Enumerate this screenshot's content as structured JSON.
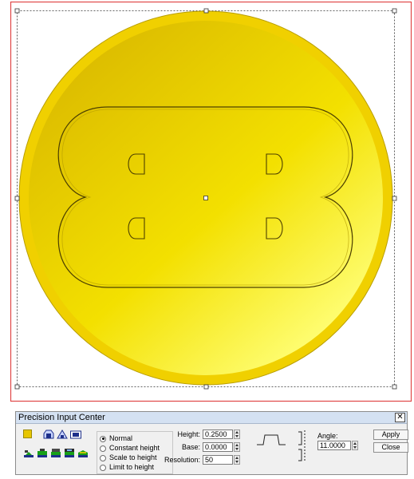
{
  "canvas": {
    "colors": {
      "selection_box": "#e04848",
      "bounding_dotted": "#333333",
      "coin_rim": "#f0d000",
      "coin_face_dark": "#e3c300",
      "coin_face_light": "#ffff6a",
      "outline": "#5a4a00"
    },
    "icons": [
      "selection-handle-icon",
      "center-handle-icon"
    ]
  },
  "panel": {
    "title": "Precision Input Center",
    "close_label": "✕",
    "color_swatch": "#e7c600",
    "tool_icons_row1": [
      "bevel-flat-icon",
      "bevel-round-icon",
      "bevel-angle-icon"
    ],
    "tool_icons_row2": [
      "stack-1-icon",
      "stack-2-icon",
      "stack-3-icon",
      "stack-4-icon",
      "stack-5-icon"
    ],
    "modes": [
      {
        "label": "Normal",
        "selected": true
      },
      {
        "label": "Constant height",
        "selected": false
      },
      {
        "label": "Scale to height",
        "selected": false
      },
      {
        "label": "Limit to height",
        "selected": false
      }
    ],
    "height_label": "Height:",
    "height_value": "0.2500",
    "base_label": "Base:",
    "base_value": "0.0000",
    "resolution_label": "Resolution:",
    "resolution_value": "50",
    "angle_label": "Angle:",
    "angle_value": "11.0000",
    "apply_label": "Apply",
    "close_button_label": "Close"
  }
}
